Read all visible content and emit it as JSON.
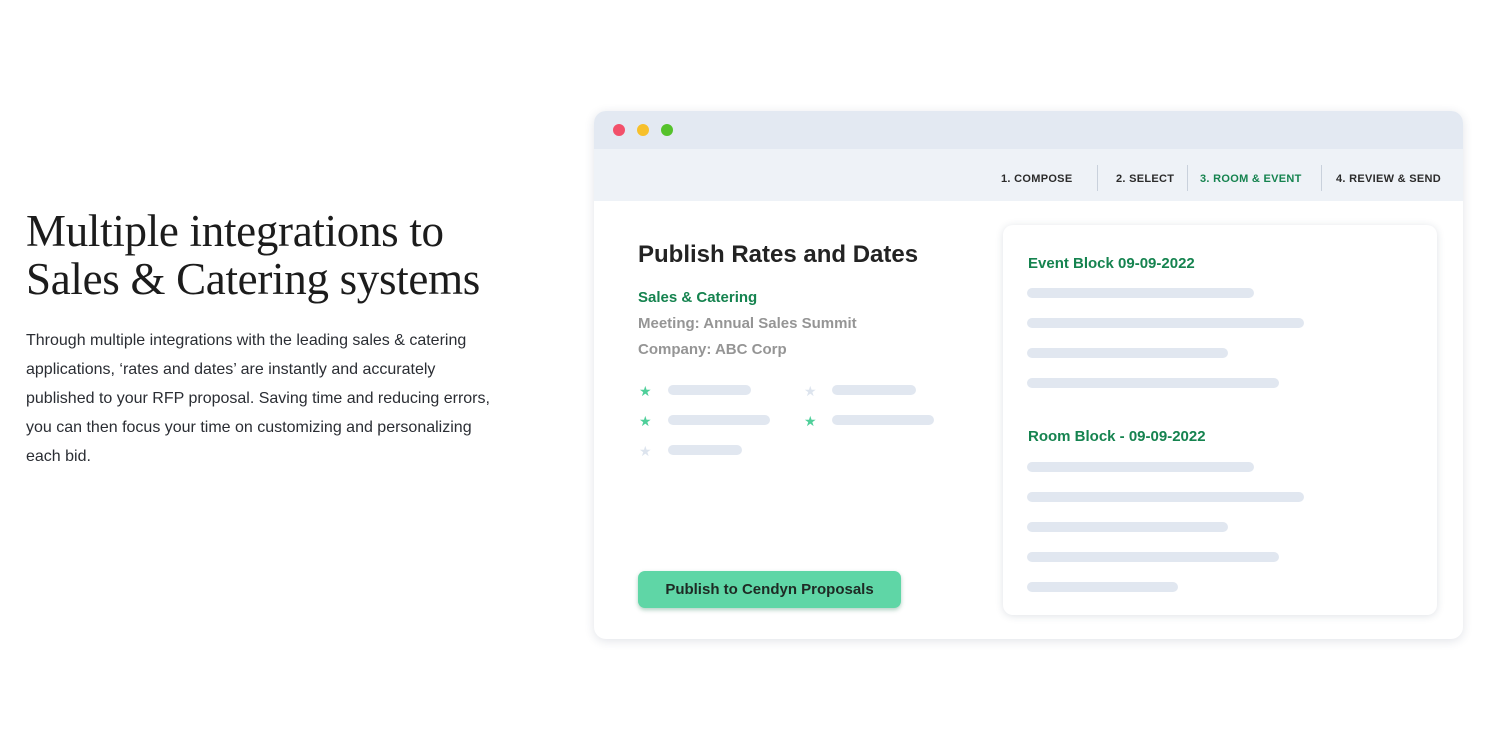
{
  "hero": {
    "headline_lines": [
      "Multiple integrations to",
      "Sales & Catering systems"
    ],
    "body_lines": [
      "Through multiple integrations with the leading sales & catering",
      "applications, ‘rates and dates’ are instantly and accurately",
      "published to your RFP proposal. Saving time and reducing errors,",
      "you can then focus your time on customizing and personalizing",
      "each bid."
    ]
  },
  "window": {
    "traffic_lights": {
      "close": "#f2506a",
      "minimize": "#f7c02b",
      "maximize": "#55c22b"
    },
    "steps": [
      {
        "label": "1.  COMPOSE",
        "active": false
      },
      {
        "label": "2.  SELECT",
        "active": false
      },
      {
        "label": "3.  ROOM & EVENT",
        "active": true
      },
      {
        "label": "4.  REVIEW & SEND",
        "active": false
      }
    ],
    "publish_panel": {
      "title": "Publish Rates and Dates",
      "subtitle": "Sales & Catering",
      "meeting": "Meeting: Annual Sales Summit",
      "company": "Company: ABC Corp",
      "star_icons": [
        "star-filled",
        "star-empty",
        "star-filled",
        "star-filled",
        "star-empty"
      ],
      "button_label": "Publish to Cendyn Proposals"
    },
    "blocks_card": {
      "event_block_title": "Event Block 09-09-2022",
      "room_block_title": "Room Block - 09-09-2022"
    },
    "colors": {
      "accent_green": "#15834f",
      "button_green": "#5fd6a6",
      "star_green": "#4fcf9a"
    }
  }
}
